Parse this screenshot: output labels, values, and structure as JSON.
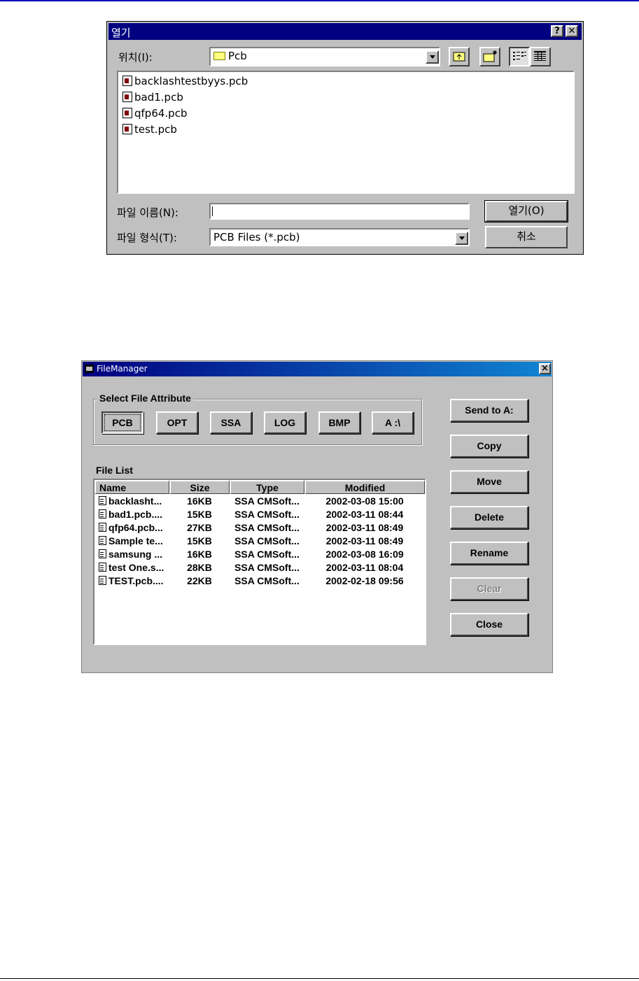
{
  "open_dialog": {
    "title": "열기",
    "help_glyph": "?",
    "close_glyph": "✕",
    "location_label": "위치(I):",
    "location_value": "Pcb",
    "files": [
      "backlashtestbyys.pcb",
      "bad1.pcb",
      "qfp64.pcb",
      "test.pcb"
    ],
    "filename_label": "파일 이름(N):",
    "filename_value": "",
    "filetype_label": "파일 형식(T):",
    "filetype_value": "PCB Files (*.pcb)",
    "open_button": "열기(O)",
    "cancel_button": "취소",
    "icons": [
      "folder-icon",
      "up-folder-icon",
      "new-folder-icon",
      "list-view-icon",
      "details-view-icon"
    ]
  },
  "file_manager": {
    "title": "FileManager",
    "close_glyph": "×",
    "attribute_group_label": "Select File Attribute",
    "attribute_buttons": [
      "PCB",
      "OPT",
      "SSA",
      "LOG",
      "BMP",
      "A :\\"
    ],
    "file_list_label": "File List",
    "columns": [
      "Name",
      "Size",
      "Type",
      "Modified"
    ],
    "rows": [
      [
        "backlasht...",
        "16KB",
        "SSA CMSoft...",
        "2002-03-08 15:00"
      ],
      [
        "bad1.pcb....",
        "15KB",
        "SSA CMSoft...",
        "2002-03-11 08:44"
      ],
      [
        "qfp64.pcb...",
        "27KB",
        "SSA CMSoft...",
        "2002-03-11 08:49"
      ],
      [
        "Sample te...",
        "15KB",
        "SSA CMSoft...",
        "2002-03-11 08:49"
      ],
      [
        "samsung ...",
        "16KB",
        "SSA CMSoft...",
        "2002-03-08 16:09"
      ],
      [
        "test One.s...",
        "28KB",
        "SSA CMSoft...",
        "2002-03-11 08:04"
      ],
      [
        "TEST.pcb....",
        "22KB",
        "SSA CMSoft...",
        "2002-02-18 09:56"
      ]
    ],
    "action_buttons": [
      "Send to A:",
      "Copy",
      "Move",
      "Delete",
      "Rename",
      "Clear",
      "Close"
    ]
  },
  "colors": {
    "title_bar": "#000080",
    "face": "#c0c0c0",
    "disabled_text": "#808080"
  }
}
